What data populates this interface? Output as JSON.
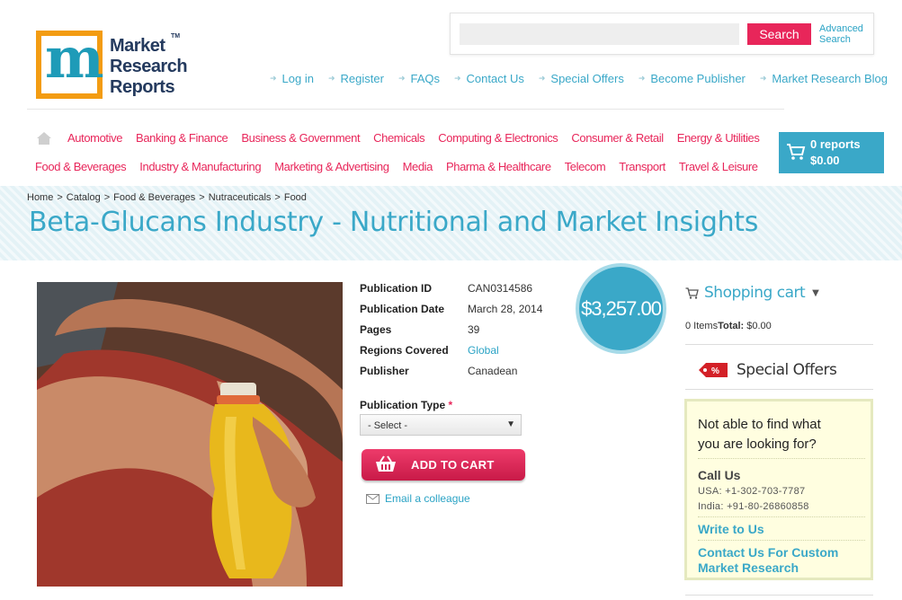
{
  "logo": {
    "mark": "m",
    "line1": "Market",
    "line2": "Research",
    "line3": "Reports",
    "tm": "TM"
  },
  "search": {
    "placeholder": "",
    "button_label": "Search",
    "advanced_line1": "Advanced",
    "advanced_line2": "Search"
  },
  "top_links": [
    "Log in",
    "Register",
    "FAQs",
    "Contact Us",
    "Special Offers",
    "Become Publisher",
    "Market Research Blog"
  ],
  "nav": {
    "row1": [
      "Automotive",
      "Banking & Finance",
      "Business & Government",
      "Chemicals",
      "Computing & Electronics",
      "Consumer & Retail",
      "Energy & Utilities"
    ],
    "row2": [
      "Food & Beverages",
      "Industry & Manufacturing",
      "Marketing & Advertising",
      "Media",
      "Pharma & Healthcare",
      "Telecom",
      "Transport",
      "Travel & Leisure"
    ]
  },
  "cart_top": {
    "reports": "0 reports",
    "total": "$0.00"
  },
  "breadcrumb": [
    "Home",
    "Catalog",
    "Food & Beverages",
    "Nutraceuticals",
    "Food"
  ],
  "breadcrumb_sep": ">",
  "title": "Beta-Glucans Industry - Nutritional and Market Insights",
  "product": {
    "details": [
      {
        "label": "Publication ID",
        "value": "CAN0314586"
      },
      {
        "label": "Publication Date",
        "value": "March 28, 2014"
      },
      {
        "label": "Pages",
        "value": "39"
      },
      {
        "label": "Regions Covered",
        "value": "Global"
      },
      {
        "label": "Publisher",
        "value": "Canadean"
      }
    ],
    "price": "$3,257.00",
    "pub_type_label": "Publication Type",
    "required_mark": "*",
    "select_value": "- Select -",
    "add_to_cart": "ADD TO CART",
    "email_colleague": "Email a colleague"
  },
  "sidebar": {
    "shopping_cart_title": "Shopping cart",
    "items_label": "0 Items",
    "total_label": "Total:",
    "total_value": "$0.00",
    "special_offers": "Special Offers",
    "special_tag": "%",
    "help": {
      "question_line1": "Not able to find what",
      "question_line2": "you are looking for?",
      "call_us": "Call Us",
      "usa": "USA: +1-302-703-7787",
      "india": "India: +91-80-26860858",
      "write_to_us": "Write to Us",
      "custom_line1": "Contact Us For Custom",
      "custom_line2": "Market Research"
    }
  },
  "colors": {
    "accent_blue": "#3aa8c8",
    "accent_pink": "#e8265a",
    "logo_orange": "#f39c12"
  }
}
